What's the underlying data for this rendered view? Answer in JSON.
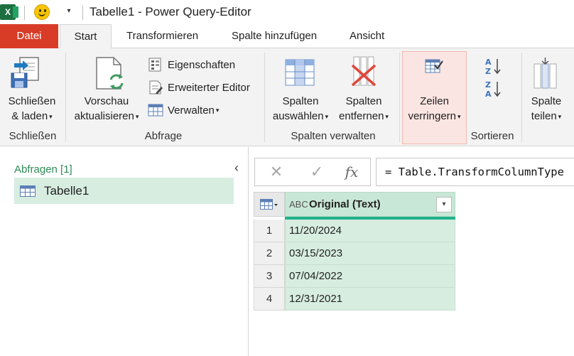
{
  "titlebar": {
    "app_icon_letter": "X",
    "title": "Tabelle1 - Power Query-Editor",
    "quick_access_dropdown": "▾"
  },
  "tabs": {
    "file": "Datei",
    "start": "Start",
    "transform": "Transformieren",
    "add_column": "Spalte hinzufügen",
    "view": "Ansicht"
  },
  "ribbon": {
    "close_group": {
      "label": "Schließen",
      "close_load_line1": "Schließen",
      "close_load_line2": "& laden"
    },
    "query_group": {
      "label": "Abfrage",
      "refresh_line1": "Vorschau",
      "refresh_line2": "aktualisieren",
      "properties": "Eigenschaften",
      "advanced_editor": "Erweiterter Editor",
      "manage": "Verwalten"
    },
    "manage_columns_group": {
      "label": "Spalten verwalten",
      "choose_line1": "Spalten",
      "choose_line2": "auswählen",
      "remove_line1": "Spalten",
      "remove_line2": "entfernen"
    },
    "reduce_rows": {
      "line1": "Zeilen",
      "line2": "verringern"
    },
    "sort_group": {
      "label": "Sortieren"
    },
    "split": {
      "line1": "Spalte",
      "line2": "teilen"
    },
    "caret": "▾"
  },
  "queries": {
    "header": "Abfragen [1]",
    "collapse_glyph": "‹",
    "items": [
      {
        "name": "Tabelle1"
      }
    ]
  },
  "formula_bar": {
    "cancel": "✕",
    "commit": "✓",
    "fx": "fx",
    "formula": "= Table.TransformColumnType"
  },
  "grid": {
    "column": {
      "type_label": "ABC",
      "name": "Original (Text)",
      "filter_glyph": "▾"
    },
    "rows": [
      {
        "num": "1",
        "value": "11/20/2024"
      },
      {
        "num": "2",
        "value": "03/15/2023"
      },
      {
        "num": "3",
        "value": "07/04/2022"
      },
      {
        "num": "4",
        "value": "12/31/2021"
      }
    ]
  },
  "colors": {
    "file_tab": "#d83c26",
    "excel_green": "#1d6f42",
    "selection_green": "#d7ede0",
    "quality_bar": "#20b28a",
    "highlight": "#fbe5e2"
  }
}
